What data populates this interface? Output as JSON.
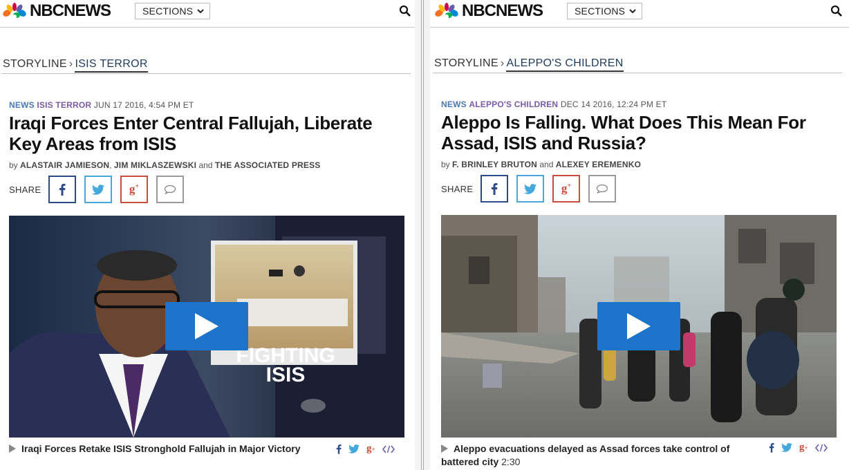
{
  "panes": [
    {
      "brand": "NBCNEWS",
      "sections_label": "SECTIONS",
      "storyline_label": "STORYLINE",
      "storyline_topic": "ISIS TERROR",
      "category": "NEWS",
      "tag": "ISIS TERROR",
      "date": "JUN 17 2016, 4:54 PM ET",
      "headline_1": "Iraqi Forces Enter Central Fallujah, Liberate",
      "headline_2": "Key Areas from ISIS",
      "byline_by": "by",
      "author_1": "ALASTAIR JAMIESON",
      "author_sep": ",",
      "author_2": "JIM MIKLASZEWSKI",
      "byline_and": "and",
      "author_3": "THE ASSOCIATED PRESS",
      "share_label": "SHARE",
      "video_overlay_1": "FIGHTING",
      "video_overlay_2": "ISIS",
      "video_caption": "Iraqi Forces Retake ISIS Stronghold Fallujah in Major Victory",
      "video_duration": ""
    },
    {
      "brand": "NBCNEWS",
      "sections_label": "SECTIONS",
      "storyline_label": "STORYLINE",
      "storyline_topic": "ALEPPO'S CHILDREN",
      "category": "NEWS",
      "tag": "ALEPPO'S CHILDREN",
      "date": "DEC 14 2016, 12:24 PM ET",
      "headline_1": "Aleppo Is Falling. What Does This Mean For",
      "headline_2": "Assad, ISIS and Russia?",
      "byline_by": "by",
      "author_1": "F. BRINLEY BRUTON",
      "byline_and": "and",
      "author_2": "ALEXEY EREMENKO",
      "share_label": "SHARE",
      "video_caption": "Aleppo evacuations delayed as Assad forces take control of battered city",
      "video_duration": "2:30"
    }
  ],
  "colors": {
    "facebook": "#2d4a8a",
    "twitter": "#45a8dc",
    "googleplus": "#c94b3a",
    "play_button": "#1b74c9",
    "tag_purple": "#7a5aa8",
    "news_blue": "#4a78b3"
  },
  "icons": [
    "nbc-peacock-icon",
    "chevron-down-icon",
    "search-icon",
    "facebook-icon",
    "twitter-icon",
    "googleplus-icon",
    "comment-icon",
    "play-icon",
    "embed-code-icon"
  ]
}
